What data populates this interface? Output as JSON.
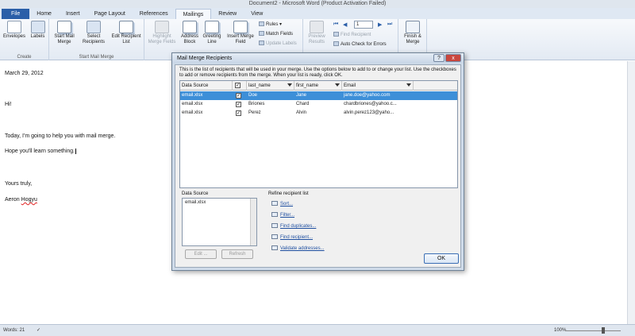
{
  "window": {
    "title": "Document2 - Microsoft Word (Product Activation Failed)"
  },
  "tabs": [
    "File",
    "Home",
    "Insert",
    "Page Layout",
    "References",
    "Mailings",
    "Review",
    "View"
  ],
  "active_tab": "Mailings",
  "ribbon": {
    "create": {
      "envelopes": "Envelopes",
      "labels": "Labels",
      "group": "Create"
    },
    "start": {
      "start_mail_merge": "Start Mail Merge",
      "select_recipients": "Select Recipients",
      "edit_recipient_list": "Edit Recipient List",
      "group": "Start Mail Merge"
    },
    "write": {
      "highlight": "Highlight Merge Fields",
      "address_block": "Address Block",
      "greeting_line": "Greeting Line",
      "insert_merge_field": "Insert Merge Field",
      "rules": "Rules",
      "match_fields": "Match Fields",
      "update_labels": "Update Labels"
    },
    "preview": {
      "preview_results": "Preview Results",
      "record": "1",
      "find_recipient": "Find Recipient",
      "auto_check": "Auto Check for Errors"
    },
    "finish": {
      "finish_merge": "Finish & Merge"
    }
  },
  "document": {
    "lines": [
      "March 29, 2012",
      "Hi!",
      "Today, I'm going to help you with mail merge.",
      "Hope you'll learn something.",
      "Yours truly,"
    ],
    "signature_first": "Aeron",
    "signature_last": "Hogyu"
  },
  "status": {
    "words": "Words: 21",
    "zoom": "100%"
  },
  "dialog": {
    "title": "Mail Merge Recipients",
    "instructions": "This is the list of recipients that will be used in your merge.  Use the options below to add to or change your list.  Use the checkboxes to add or remove recipients from the merge.  When your list is ready, click OK.",
    "columns": [
      "Data Source",
      "last_name",
      "first_name",
      "Email"
    ],
    "rows": [
      {
        "source": "email.xlsx",
        "last": "Doe",
        "first": "Jane",
        "email": "jane.doe@yahoo.com"
      },
      {
        "source": "email.xlsx",
        "last": "Briones",
        "first": "Chard",
        "email": "chardbriones@yahoo.c..."
      },
      {
        "source": "email.xlsx",
        "last": "Perez",
        "first": "Alvin",
        "email": "alvin.perez123@yaho..."
      }
    ],
    "data_source_label": "Data Source",
    "data_source_item": "email.xlsx",
    "edit": "Edit ...",
    "refresh": "Refresh",
    "refine_label": "Refine recipient list",
    "links": [
      "Sort...",
      "Filter...",
      "Find duplicates...",
      "Find recipient...",
      "Validate addresses..."
    ],
    "ok": "OK",
    "help": "?",
    "close": "x"
  }
}
